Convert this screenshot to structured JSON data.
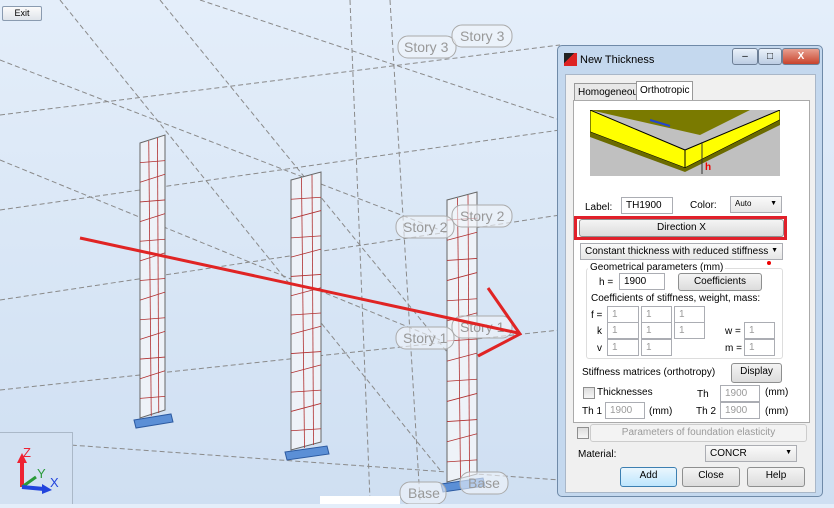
{
  "toolbar": {
    "exit_label": "Exit"
  },
  "scene": {
    "story_labels": [
      "Story 3",
      "Story 3",
      "Story 2",
      "Story 2",
      "Story 1",
      "Story 1",
      "Base",
      "Base"
    ],
    "axes": {
      "z": "Z",
      "y": "Y",
      "x": "X"
    }
  },
  "dialog": {
    "title": "New Thickness",
    "tabs": [
      "Homogeneous",
      "Orthotropic"
    ],
    "active_tab": "Orthotropic",
    "preview_label": "h",
    "label_caption": "Label:",
    "label_value": "TH1900",
    "color_caption": "Color:",
    "color_value": "Auto",
    "direction_button": "Direction X",
    "thickness_type": "Constant thickness with reduced stiffness",
    "geom_group": "Geometrical parameters (mm)",
    "h_caption": "h  =",
    "h_value": "1900",
    "coefficients_button": "Coefficients",
    "coef_caption": "Coefficients of stiffness, weight, mass:",
    "f_caption": "f =",
    "f_values": [
      "1",
      "1",
      "1"
    ],
    "k_caption": "k",
    "k_values": [
      "1",
      "1",
      "1"
    ],
    "v_caption": "v",
    "v_values": [
      "1",
      "1"
    ],
    "w_caption": "w =",
    "w_value": "1",
    "m_caption": "m =",
    "m_value": "1",
    "stiffness_caption": "Stiffness matrices (orthotropy)",
    "display_button": "Display",
    "thicknesses_caption": "Thicknesses",
    "th_caption": "Th",
    "th_value": "1900",
    "th1_caption": "Th 1",
    "th1_value": "1900",
    "th2_caption": "Th 2",
    "th2_value": "1900",
    "mm": "(mm)",
    "foundation_button": "Parameters of foundation elasticity",
    "material_caption": "Material:",
    "material_value": "CONCR",
    "add_button": "Add",
    "close_button": "Close",
    "help_button": "Help"
  },
  "colors": {
    "highlight": "#e0202a",
    "preview_yellow": "#ffff00"
  }
}
